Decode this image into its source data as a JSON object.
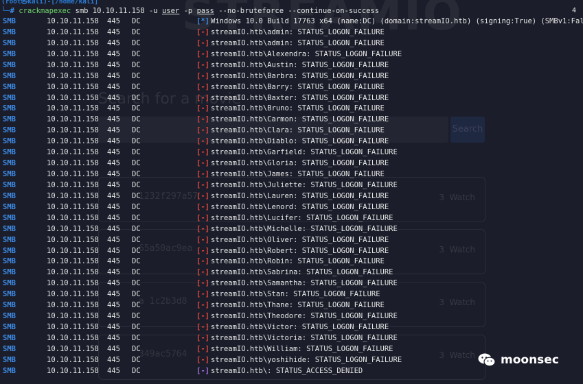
{
  "window": {
    "watermark": "STREAMIO",
    "tab_count": "4"
  },
  "background_ui": {
    "search_label": "Search for a movie",
    "search_button": "Search",
    "cards": [
      {
        "hash": "1232f297a57",
        "count": "3",
        "action": "Watch"
      },
      {
        "hash": "65a50ac9ea",
        "count": "3",
        "action": "Watch"
      },
      {
        "hash": "a 1c2b3d8",
        "count": "3",
        "action": "Watch"
      },
      {
        "hash": "349ac5764",
        "count": "3",
        "action": "Watch"
      }
    ]
  },
  "prompt": {
    "text": "(root㉿kali)-[/home/kali]"
  },
  "command": {
    "corner": "└─",
    "hash": "#",
    "tool": "crackmapexec",
    "args": "smb 10.10.11.158",
    "flag_u": "-u",
    "user_arg": "user",
    "flag_p": "-p",
    "pass_arg": "pass",
    "long_flags": "--no-bruteforce --continue-on-success"
  },
  "colors": {
    "background": "#1b1e2a",
    "proto_blue": "#3d8be8",
    "failure_red": "#e0443a",
    "denied_purple": "#a46ee0",
    "tool_green": "#6fd36a"
  },
  "rows": [
    {
      "proto": "SMB",
      "ip": "10.10.11.158",
      "port": "445",
      "name": "DC",
      "status": "[*]",
      "kind": "star",
      "msg": "Windows 10.0 Build 17763 x64 (name:DC) (domain:streamIO.htb) (signing:True) (SMBv1:False)"
    },
    {
      "proto": "SMB",
      "ip": "10.10.11.158",
      "port": "445",
      "name": "DC",
      "status": "[-]",
      "kind": "minus",
      "msg": "streamIO.htb\\admin: STATUS_LOGON_FAILURE"
    },
    {
      "proto": "SMB",
      "ip": "10.10.11.158",
      "port": "445",
      "name": "DC",
      "status": "[-]",
      "kind": "minus",
      "msg": "streamIO.htb\\admin: STATUS_LOGON_FAILURE"
    },
    {
      "proto": "SMB",
      "ip": "10.10.11.158",
      "port": "445",
      "name": "DC",
      "status": "[-]",
      "kind": "minus",
      "msg": "streamIO.htb\\Alexendra: STATUS_LOGON_FAILURE"
    },
    {
      "proto": "SMB",
      "ip": "10.10.11.158",
      "port": "445",
      "name": "DC",
      "status": "[-]",
      "kind": "minus",
      "msg": "streamIO.htb\\Austin: STATUS_LOGON_FAILURE"
    },
    {
      "proto": "SMB",
      "ip": "10.10.11.158",
      "port": "445",
      "name": "DC",
      "status": "[-]",
      "kind": "minus",
      "msg": "streamIO.htb\\Barbra: STATUS_LOGON_FAILURE"
    },
    {
      "proto": "SMB",
      "ip": "10.10.11.158",
      "port": "445",
      "name": "DC",
      "status": "[-]",
      "kind": "minus",
      "msg": "streamIO.htb\\Barry: STATUS_LOGON_FAILURE"
    },
    {
      "proto": "SMB",
      "ip": "10.10.11.158",
      "port": "445",
      "name": "DC",
      "status": "[-]",
      "kind": "minus",
      "msg": "streamIO.htb\\Baxter: STATUS_LOGON_FAILURE"
    },
    {
      "proto": "SMB",
      "ip": "10.10.11.158",
      "port": "445",
      "name": "DC",
      "status": "[-]",
      "kind": "minus",
      "msg": "streamIO.htb\\Bruno: STATUS_LOGON_FAILURE"
    },
    {
      "proto": "SMB",
      "ip": "10.10.11.158",
      "port": "445",
      "name": "DC",
      "status": "[-]",
      "kind": "minus",
      "msg": "streamIO.htb\\Carmon: STATUS_LOGON_FAILURE"
    },
    {
      "proto": "SMB",
      "ip": "10.10.11.158",
      "port": "445",
      "name": "DC",
      "status": "[-]",
      "kind": "minus",
      "msg": "streamIO.htb\\Clara: STATUS_LOGON_FAILURE"
    },
    {
      "proto": "SMB",
      "ip": "10.10.11.158",
      "port": "445",
      "name": "DC",
      "status": "[-]",
      "kind": "minus",
      "msg": "streamIO.htb\\Diablo: STATUS_LOGON_FAILURE"
    },
    {
      "proto": "SMB",
      "ip": "10.10.11.158",
      "port": "445",
      "name": "DC",
      "status": "[-]",
      "kind": "minus",
      "msg": "streamIO.htb\\Garfield: STATUS_LOGON_FAILURE"
    },
    {
      "proto": "SMB",
      "ip": "10.10.11.158",
      "port": "445",
      "name": "DC",
      "status": "[-]",
      "kind": "minus",
      "msg": "streamIO.htb\\Gloria: STATUS_LOGON_FAILURE"
    },
    {
      "proto": "SMB",
      "ip": "10.10.11.158",
      "port": "445",
      "name": "DC",
      "status": "[-]",
      "kind": "minus",
      "msg": "streamIO.htb\\James: STATUS_LOGON_FAILURE"
    },
    {
      "proto": "SMB",
      "ip": "10.10.11.158",
      "port": "445",
      "name": "DC",
      "status": "[-]",
      "kind": "minus",
      "msg": "streamIO.htb\\Juliette: STATUS_LOGON_FAILURE"
    },
    {
      "proto": "SMB",
      "ip": "10.10.11.158",
      "port": "445",
      "name": "DC",
      "status": "[-]",
      "kind": "minus",
      "msg": "streamIO.htb\\Lauren: STATUS_LOGON_FAILURE"
    },
    {
      "proto": "SMB",
      "ip": "10.10.11.158",
      "port": "445",
      "name": "DC",
      "status": "[-]",
      "kind": "minus",
      "msg": "streamIO.htb\\Lenord: STATUS_LOGON_FAILURE"
    },
    {
      "proto": "SMB",
      "ip": "10.10.11.158",
      "port": "445",
      "name": "DC",
      "status": "[-]",
      "kind": "minus",
      "msg": "streamIO.htb\\Lucifer: STATUS_LOGON_FAILURE"
    },
    {
      "proto": "SMB",
      "ip": "10.10.11.158",
      "port": "445",
      "name": "DC",
      "status": "[-]",
      "kind": "minus",
      "msg": "streamIO.htb\\Michelle: STATUS_LOGON_FAILURE"
    },
    {
      "proto": "SMB",
      "ip": "10.10.11.158",
      "port": "445",
      "name": "DC",
      "status": "[-]",
      "kind": "minus",
      "msg": "streamIO.htb\\Oliver: STATUS_LOGON_FAILURE"
    },
    {
      "proto": "SMB",
      "ip": "10.10.11.158",
      "port": "445",
      "name": "DC",
      "status": "[-]",
      "kind": "minus",
      "msg": "streamIO.htb\\Robert: STATUS_LOGON_FAILURE"
    },
    {
      "proto": "SMB",
      "ip": "10.10.11.158",
      "port": "445",
      "name": "DC",
      "status": "[-]",
      "kind": "minus",
      "msg": "streamIO.htb\\Robin: STATUS_LOGON_FAILURE"
    },
    {
      "proto": "SMB",
      "ip": "10.10.11.158",
      "port": "445",
      "name": "DC",
      "status": "[-]",
      "kind": "minus",
      "msg": "streamIO.htb\\Sabrina: STATUS_LOGON_FAILURE"
    },
    {
      "proto": "SMB",
      "ip": "10.10.11.158",
      "port": "445",
      "name": "DC",
      "status": "[-]",
      "kind": "minus",
      "msg": "streamIO.htb\\Samantha: STATUS_LOGON_FAILURE"
    },
    {
      "proto": "SMB",
      "ip": "10.10.11.158",
      "port": "445",
      "name": "DC",
      "status": "[-]",
      "kind": "minus",
      "msg": "streamIO.htb\\Stan: STATUS_LOGON_FAILURE"
    },
    {
      "proto": "SMB",
      "ip": "10.10.11.158",
      "port": "445",
      "name": "DC",
      "status": "[-]",
      "kind": "minus",
      "msg": "streamIO.htb\\Thane: STATUS_LOGON_FAILURE"
    },
    {
      "proto": "SMB",
      "ip": "10.10.11.158",
      "port": "445",
      "name": "DC",
      "status": "[-]",
      "kind": "minus",
      "msg": "streamIO.htb\\Theodore: STATUS_LOGON_FAILURE"
    },
    {
      "proto": "SMB",
      "ip": "10.10.11.158",
      "port": "445",
      "name": "DC",
      "status": "[-]",
      "kind": "minus",
      "msg": "streamIO.htb\\Victor: STATUS_LOGON_FAILURE"
    },
    {
      "proto": "SMB",
      "ip": "10.10.11.158",
      "port": "445",
      "name": "DC",
      "status": "[-]",
      "kind": "minus",
      "msg": "streamIO.htb\\Victoria: STATUS_LOGON_FAILURE"
    },
    {
      "proto": "SMB",
      "ip": "10.10.11.158",
      "port": "445",
      "name": "DC",
      "status": "[-]",
      "kind": "minus",
      "msg": "streamIO.htb\\William: STATUS_LOGON_FAILURE"
    },
    {
      "proto": "SMB",
      "ip": "10.10.11.158",
      "port": "445",
      "name": "DC",
      "status": "[-]",
      "kind": "minus",
      "msg": "streamIO.htb\\yoshihide: STATUS_LOGON_FAILURE"
    },
    {
      "proto": "SMB",
      "ip": "10.10.11.158",
      "port": "445",
      "name": "DC",
      "status": "[-]",
      "kind": "plus",
      "msg": "streamIO.htb\\: STATUS_ACCESS_DENIED"
    }
  ],
  "brand": {
    "icon": "wechat-icon",
    "name": "moonsec"
  }
}
